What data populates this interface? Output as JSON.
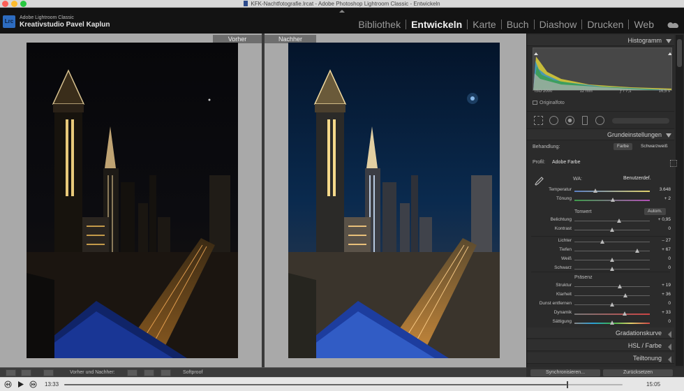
{
  "window": {
    "title": "KFK-Nachtfotografie.lrcat - Adobe Photoshop Lightroom Classic - Entwickeln"
  },
  "identity": {
    "app": "Adobe Lightroom Classic",
    "studio": "Kreativstudio Pavel Kaplun",
    "logo": "Lrc"
  },
  "modules": [
    {
      "label": "Bibliothek",
      "active": false
    },
    {
      "label": "Entwickeln",
      "active": true
    },
    {
      "label": "Karte",
      "active": false
    },
    {
      "label": "Buch",
      "active": false
    },
    {
      "label": "Diashow",
      "active": false
    },
    {
      "label": "Drucken",
      "active": false
    },
    {
      "label": "Web",
      "active": false
    }
  ],
  "compare": {
    "before_label": "Vorher",
    "after_label": "Nachher"
  },
  "histogram": {
    "title": "Histogramm",
    "iso": "ISO 2000",
    "focal": "12 mm",
    "aperture": "ƒ / 7,1",
    "shutter": "16,5 s",
    "original_photo": "Originalfoto"
  },
  "basic": {
    "title": "Grundeinstellungen",
    "treatment_label": "Behandlung:",
    "treatment_color": "Farbe",
    "treatment_bw": "Schwarzweiß",
    "profile_label": "Profil:",
    "profile_value": "Adobe Farbe",
    "wb_label": "WA:",
    "wb_value": "Benutzerdef.",
    "tone_label": "Tonwert",
    "auto_label": "Autom.",
    "presence_label": "Präsenz",
    "sliders": [
      {
        "label": "Temperatur",
        "value": "3.648",
        "pos": 0.28,
        "track": "temp"
      },
      {
        "label": "Tönung",
        "value": "+ 2",
        "pos": 0.51,
        "track": "tint"
      },
      {
        "label": "Belichtung",
        "value": "+ 0,95",
        "pos": 0.59,
        "track": ""
      },
      {
        "label": "Kontrast",
        "value": "0",
        "pos": 0.5,
        "track": ""
      },
      {
        "label": "Lichter",
        "value": "– 27",
        "pos": 0.37,
        "track": ""
      },
      {
        "label": "Tiefen",
        "value": "+ 67",
        "pos": 0.83,
        "track": ""
      },
      {
        "label": "Weiß",
        "value": "0",
        "pos": 0.5,
        "track": ""
      },
      {
        "label": "Schwarz",
        "value": "0",
        "pos": 0.5,
        "track": ""
      },
      {
        "label": "Struktur",
        "value": "+ 19",
        "pos": 0.6,
        "track": ""
      },
      {
        "label": "Klarheit",
        "value": "+ 36",
        "pos": 0.68,
        "track": ""
      },
      {
        "label": "Dunst entfernen",
        "value": "0",
        "pos": 0.5,
        "track": ""
      },
      {
        "label": "Dynamik",
        "value": "+ 33",
        "pos": 0.67,
        "track": "vib"
      },
      {
        "label": "Sättigung",
        "value": "0",
        "pos": 0.5,
        "track": "sat"
      }
    ]
  },
  "panels": [
    {
      "label": "Gradationskurve"
    },
    {
      "label": "HSL / Farbe"
    },
    {
      "label": "Teiltonung"
    }
  ],
  "toolbar": {
    "before_after_label": "Vorher und Nachher:",
    "softproof_label": "Softproof",
    "sync_label": "Synchronisieren...",
    "reset_label": "Zurücksetzen"
  },
  "player": {
    "current_time": "13:33",
    "end_time": "15:05",
    "progress": 0.9
  }
}
